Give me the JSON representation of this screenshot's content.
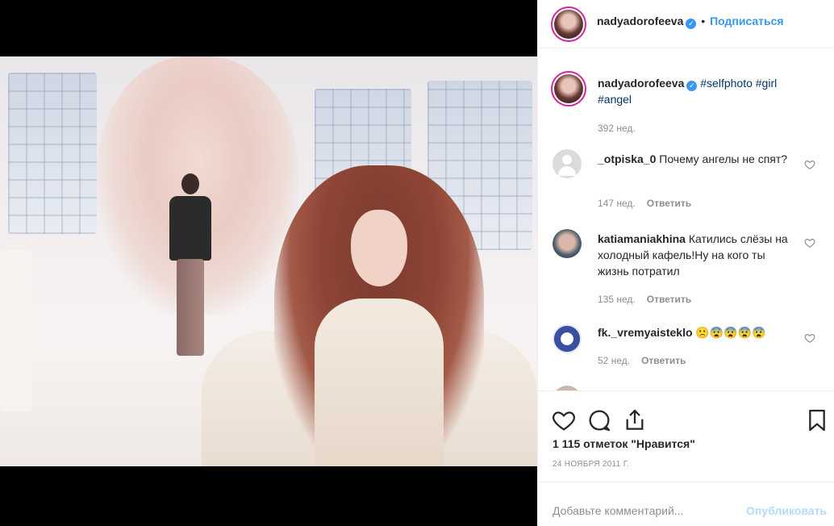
{
  "header": {
    "username": "nadyadorofeeva",
    "separator": "•",
    "follow_label": "Подписаться"
  },
  "caption": {
    "username": "nadyadorofeeva",
    "tags": [
      "#selfphoto",
      "#girl",
      "#angel"
    ],
    "time": "392 нед."
  },
  "comments": [
    {
      "username": "_otpiska_0",
      "text": "Почему ангелы не спят?",
      "time": "147 нед.",
      "reply": "Ответить"
    },
    {
      "username": "katiamaniakhina",
      "text": "Катились слёзы на холодный кафель!Ну на кого ты жизнь потратил",
      "time": "135 нед.",
      "reply": "Ответить"
    },
    {
      "username": "fk._vremyaisteklo",
      "text": "🙁😨😨😨😨",
      "time": "52 нед.",
      "reply": "Ответить"
    }
  ],
  "likes": "1 115 отметок \"Нравится\"",
  "date": "24 ноября 2011 г.",
  "add_comment": {
    "placeholder": "Добавьте комментарий...",
    "publish": "Опубликовать"
  },
  "icons": {
    "verified": "verified-badge-icon",
    "like": "heart-icon",
    "comment": "comment-bubble-icon",
    "share": "share-icon",
    "save": "bookmark-icon"
  },
  "colors": {
    "accent": "#3897f0",
    "publish_disabled": "#b3dbff",
    "muted": "#8e8e8e",
    "text": "#262626"
  }
}
